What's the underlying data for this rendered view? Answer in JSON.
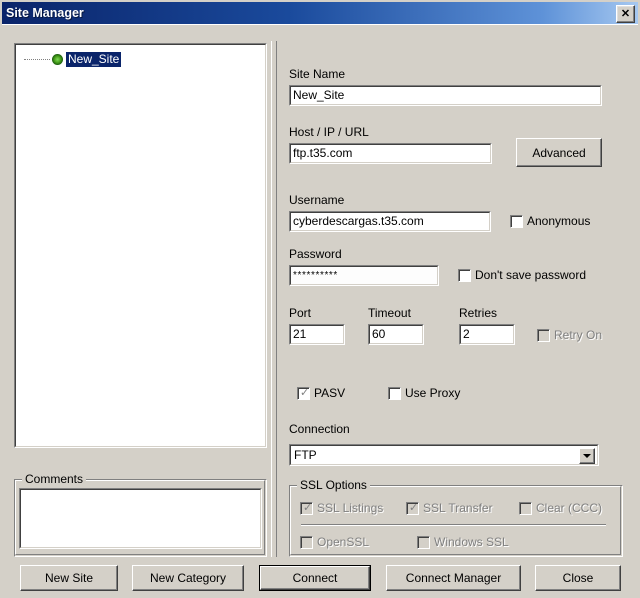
{
  "window": {
    "title": "Site Manager",
    "close_icon": "close-icon",
    "close_label": "✕"
  },
  "sidebar": {
    "tree": {
      "nodes": [
        {
          "label": "New_Site",
          "icon": "green-circle-site-icon",
          "selected": true
        }
      ]
    },
    "comments": {
      "group_label": "Comments",
      "value": "",
      "placeholder": ""
    }
  },
  "form": {
    "site_name": {
      "label": "Site Name",
      "value": "New_Site"
    },
    "host": {
      "label": "Host / IP / URL",
      "value": "ftp.t35.com"
    },
    "advanced_button": "Advanced",
    "username": {
      "label": "Username",
      "value": "cyberdescargas.t35.com"
    },
    "anonymous": {
      "label": "Anonymous",
      "checked": false
    },
    "password": {
      "label": "Password",
      "value": "**********"
    },
    "dont_save_password": {
      "label": "Don't save password",
      "checked": false
    },
    "port": {
      "label": "Port",
      "value": "21"
    },
    "timeout": {
      "label": "Timeout",
      "value": "60"
    },
    "retries": {
      "label": "Retries",
      "value": "2"
    },
    "retry_on": {
      "label": "Retry On",
      "checked": false
    },
    "pasv": {
      "label": "PASV",
      "checked": true
    },
    "use_proxy": {
      "label": "Use Proxy",
      "checked": false
    },
    "connection": {
      "label": "Connection",
      "value": "FTP",
      "arrow_icon": "chevron-down-icon"
    }
  },
  "ssl_options": {
    "group_label": "SSL Options",
    "items": [
      {
        "label": "SSL Listings",
        "checked": true,
        "disabled": true
      },
      {
        "label": "SSL Transfer",
        "checked": true,
        "disabled": true
      },
      {
        "label": "Clear (CCC)",
        "checked": false,
        "disabled": true
      },
      {
        "label": "OpenSSL",
        "checked": false,
        "disabled": true
      },
      {
        "label": "Windows SSL",
        "checked": false,
        "disabled": true
      }
    ]
  },
  "buttons": {
    "new_site": "New Site",
    "new_category": "New Category",
    "connect": "Connect",
    "connect_manager": "Connect Manager",
    "close": "Close"
  },
  "colors": {
    "face": "#d4d0c8",
    "titlebar_start": "#0a246a",
    "titlebar_end": "#a6c8f0",
    "selection": "#0a246a",
    "disabled_text": "#808080"
  }
}
